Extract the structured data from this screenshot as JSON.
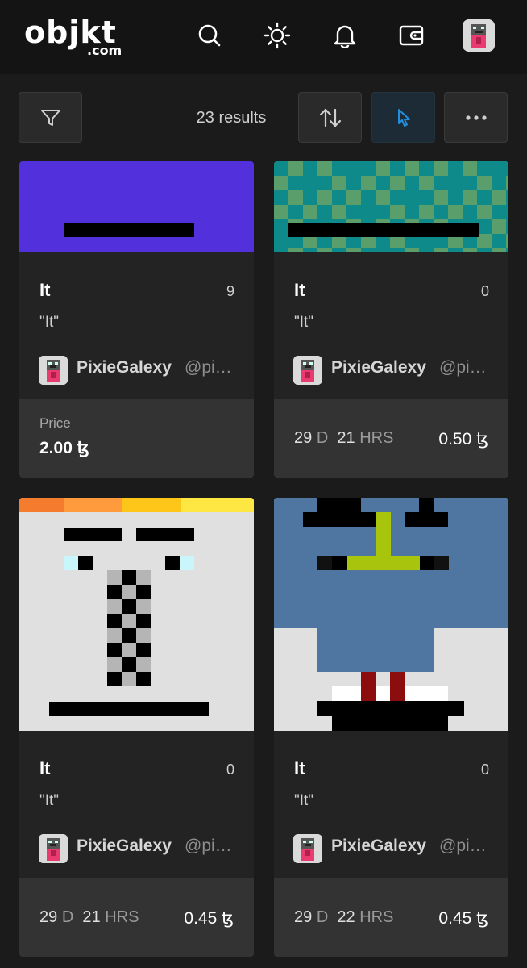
{
  "header": {
    "logo_main": "objkt",
    "logo_sub": ".com",
    "icons": [
      "search-icon",
      "sun-icon",
      "bell-icon",
      "wallet-icon",
      "profile-avatar"
    ]
  },
  "toolbar": {
    "results_label": "23 results",
    "buttons": [
      "filter-icon",
      "sort-icon",
      "cursor-icon",
      "more-icon"
    ],
    "accent_color": "#1f8fe0"
  },
  "cards": [
    {
      "title": "It",
      "count": "9",
      "description": "\"It\"",
      "creator_name": "PixieGalexy",
      "creator_handle": "@pixiegalexy",
      "price_label": "Price",
      "price": "2.00 ꜩ"
    },
    {
      "title": "It",
      "count": "0",
      "description": "\"It\"",
      "creator_name": "PixieGalexy",
      "creator_handle": "@pixiegalexy",
      "days": "29",
      "days_unit": "D",
      "hours": "21",
      "hours_unit": "HRS",
      "price": "0.50 ꜩ"
    },
    {
      "title": "It",
      "count": "0",
      "description": "\"It\"",
      "creator_name": "PixieGalexy",
      "creator_handle": "@pixiegalexy",
      "days": "29",
      "days_unit": "D",
      "hours": "21",
      "hours_unit": "HRS",
      "price": "0.45 ꜩ"
    },
    {
      "title": "It",
      "count": "0",
      "description": "\"It\"",
      "creator_name": "PixieGalexy",
      "creator_handle": "@pixiegalexy",
      "days": "29",
      "days_unit": "D",
      "hours": "22",
      "hours_unit": "HRS",
      "price": "0.45 ꜩ"
    }
  ]
}
